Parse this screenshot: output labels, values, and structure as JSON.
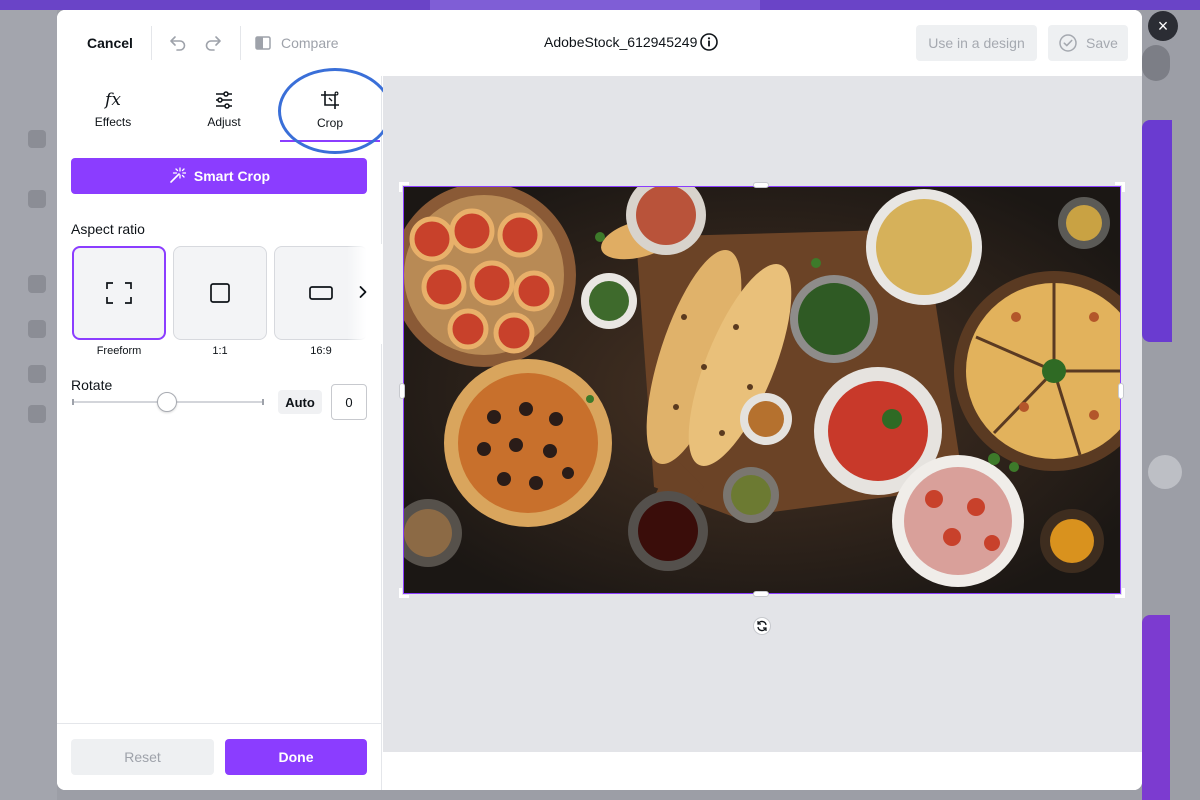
{
  "app": {
    "close_glyph": "×"
  },
  "toolbar": {
    "cancel_label": "Cancel",
    "compare_label": "Compare",
    "filename": "AdobeStock_612945249",
    "use_in_design_label": "Use in a design",
    "save_label": "Save"
  },
  "tabs": [
    {
      "label": "Effects",
      "icon": "fx-icon"
    },
    {
      "label": "Adjust",
      "icon": "sliders-icon"
    },
    {
      "label": "Crop",
      "icon": "crop-icon",
      "active": true
    }
  ],
  "crop_panel": {
    "smart_crop_label": "Smart Crop",
    "aspect_ratio_heading": "Aspect ratio",
    "ratios": [
      {
        "label": "Freeform",
        "selected": true
      },
      {
        "label": "1:1"
      },
      {
        "label": "16:9"
      }
    ],
    "rotate_heading": "Rotate",
    "rotate_auto_label": "Auto",
    "rotate_value": "0"
  },
  "footer": {
    "reset_label": "Reset",
    "done_label": "Done"
  },
  "colors": {
    "accent": "#8b3dff",
    "highlight_ring": "#3a6fd8"
  }
}
